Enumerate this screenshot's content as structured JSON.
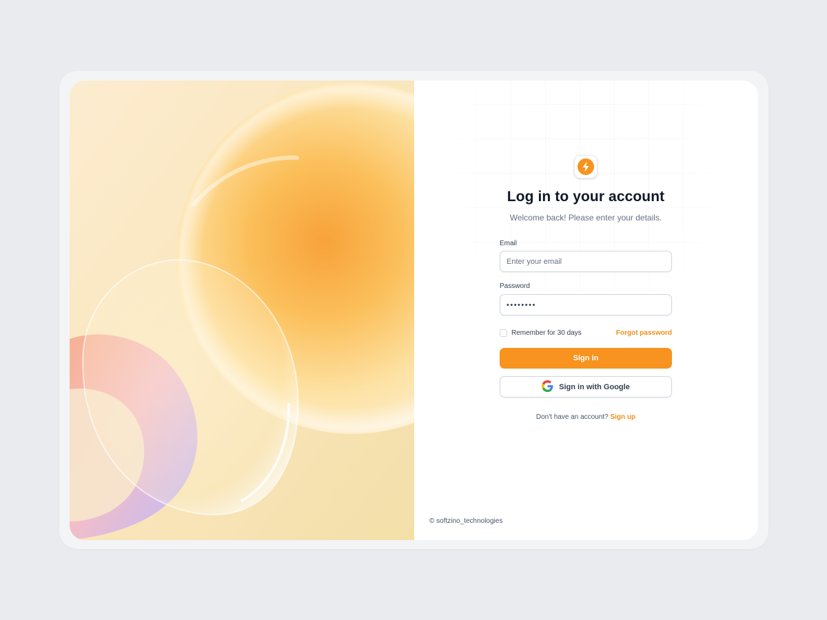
{
  "login": {
    "title": "Log in to your account",
    "subtitle": "Welcome back! Please enter your details.",
    "email_label": "Email",
    "email_placeholder": "Enter your email",
    "password_label": "Password",
    "password_value": "••••••••",
    "remember_label": "Remember for 30 days",
    "forgot_label": "Forgot password",
    "signin_label": "Sign in",
    "google_label": "Sign in with Google",
    "no_account_text": "Don't have an account?",
    "signup_label": "Sign up"
  },
  "footer": {
    "copyright": "© softzino_technologies"
  },
  "icons": {
    "logo": "lightning-bolt-icon",
    "google": "google-g-icon"
  },
  "colors": {
    "accent": "#f7931e",
    "page_background": "#e9ebef",
    "title_text": "#101828",
    "muted_text": "#667085"
  }
}
